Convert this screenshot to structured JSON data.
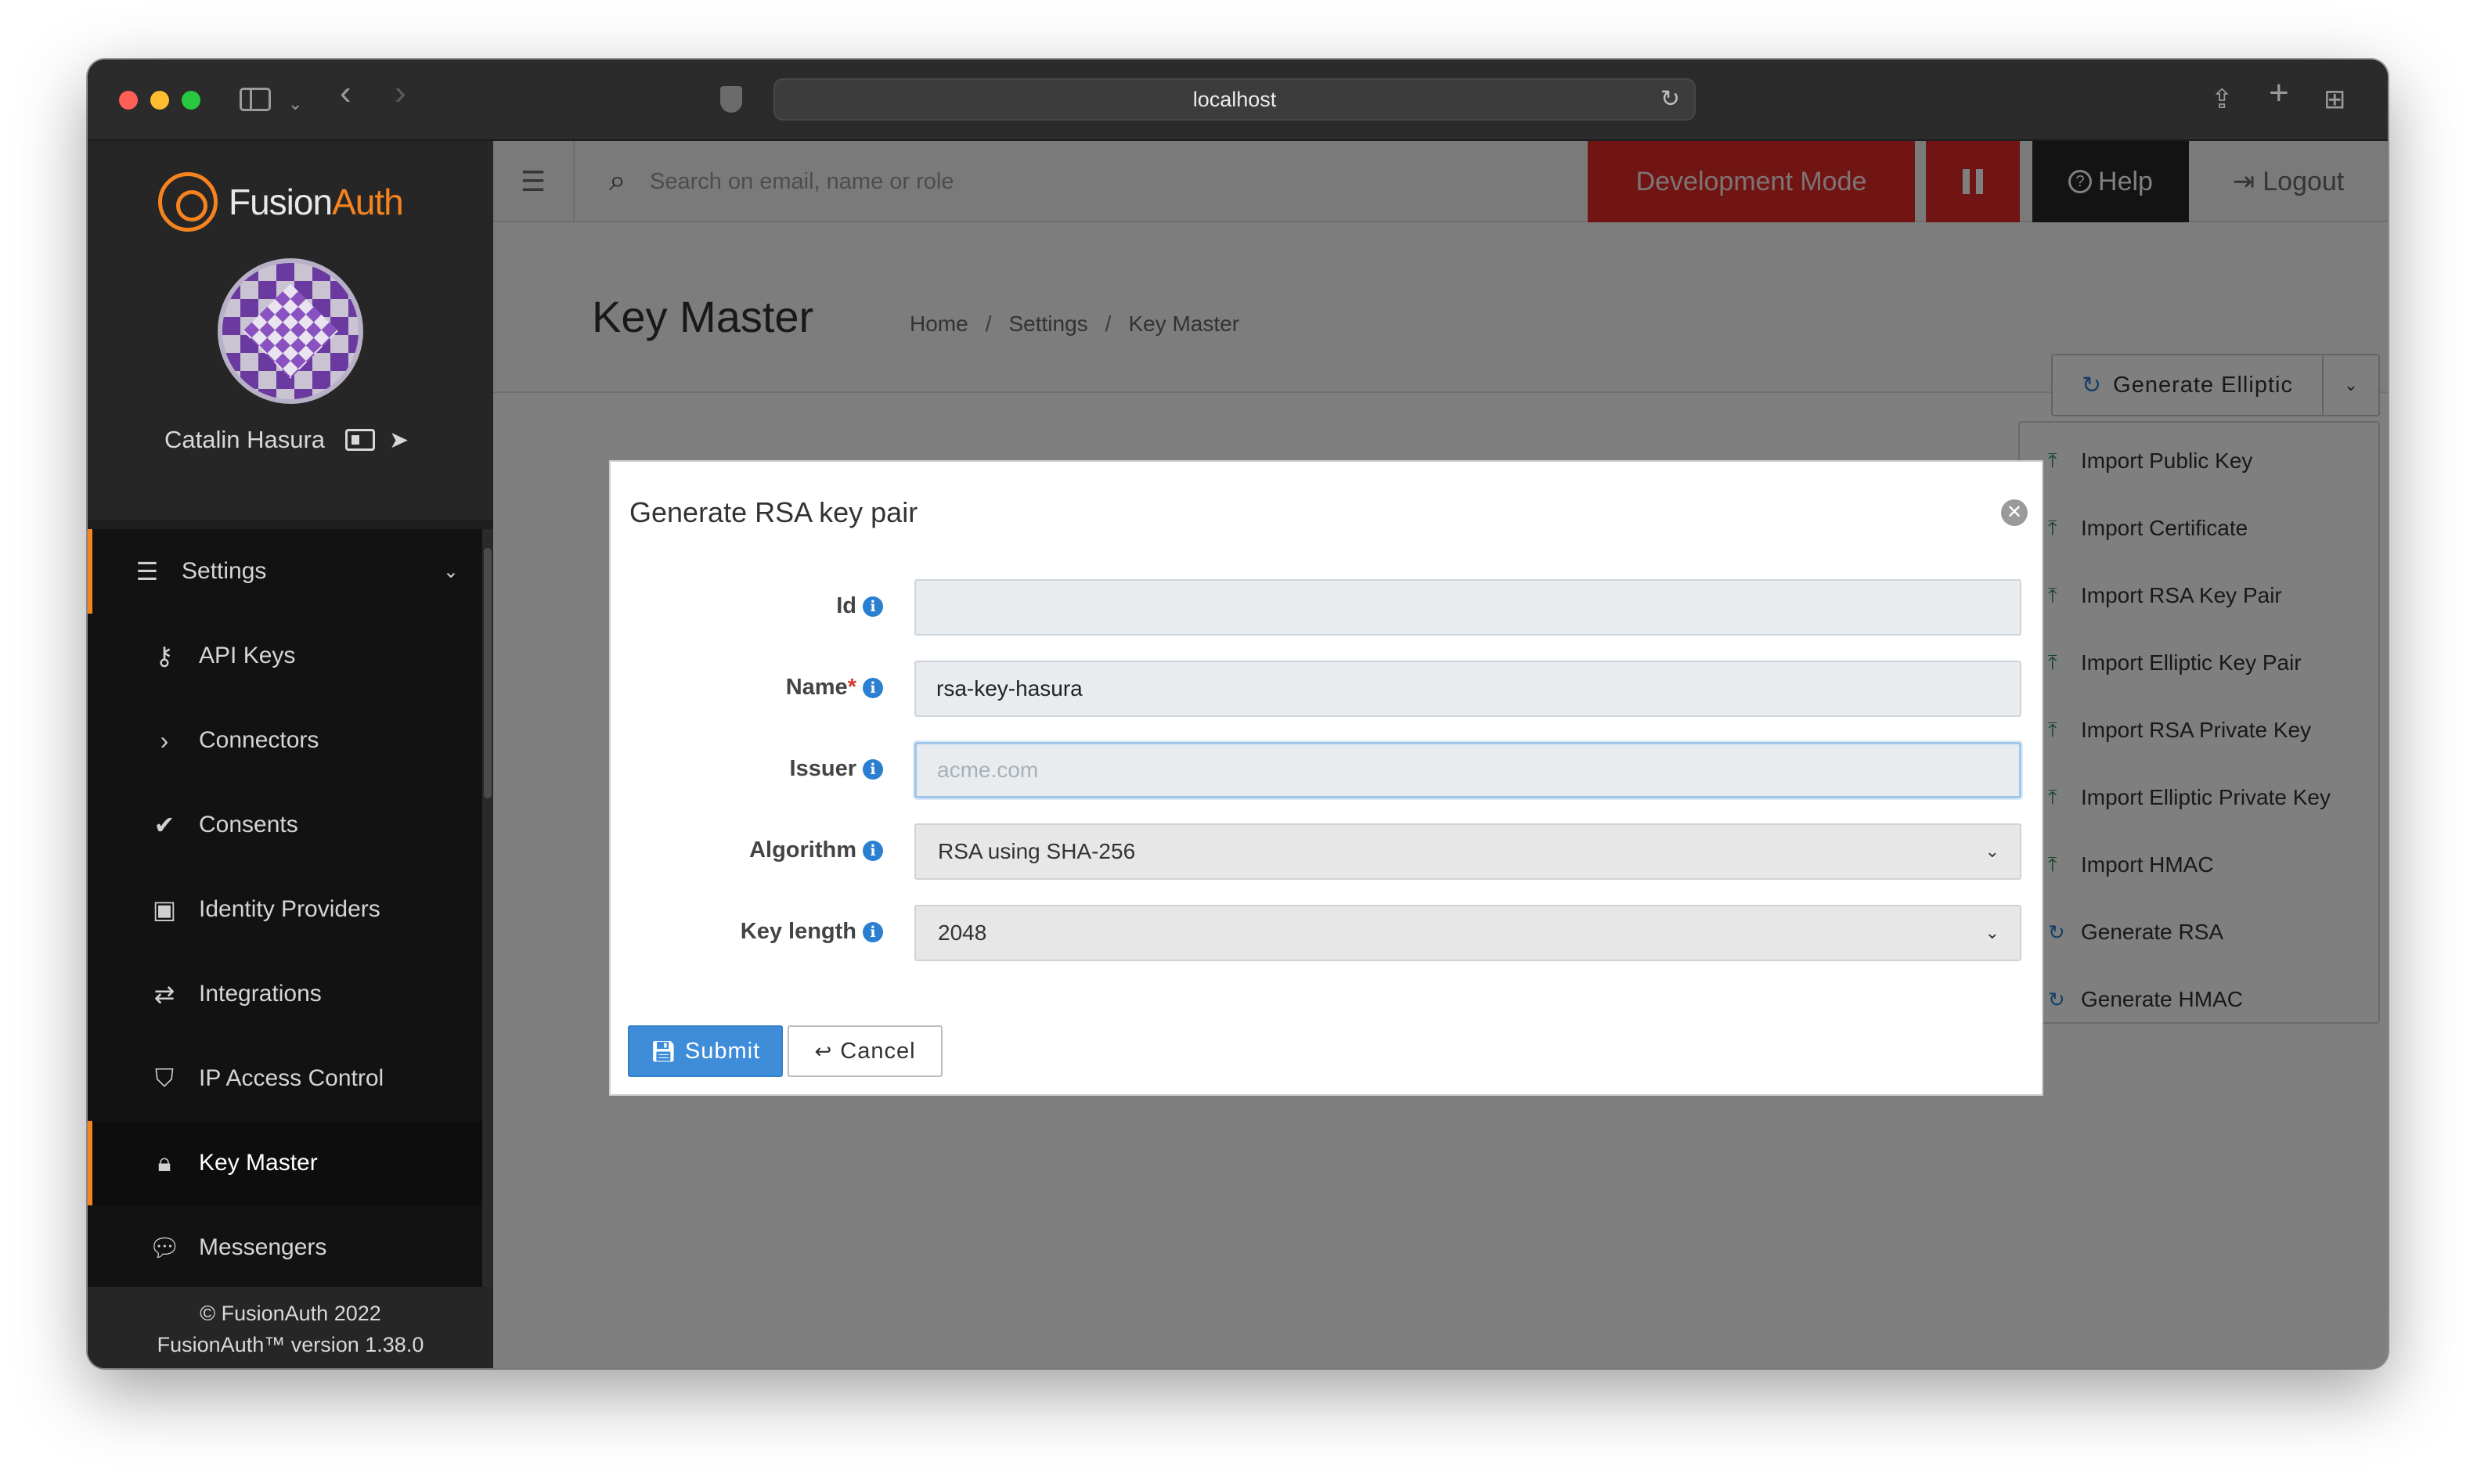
{
  "browser": {
    "url": "localhost"
  },
  "app": {
    "logo_part1": "Fusion",
    "logo_part2": "Auth",
    "user_name": "Catalin Hasura",
    "footer_copyright": "© FusionAuth 2022",
    "footer_version": "FusionAuth™ version 1.38.0"
  },
  "sidebar": {
    "section_label": "Settings",
    "items": [
      {
        "label": "API Keys",
        "icon": "key-icon"
      },
      {
        "label": "Connectors",
        "icon": "chevron-right-icon"
      },
      {
        "label": "Consents",
        "icon": "check-icon"
      },
      {
        "label": "Identity Providers",
        "icon": "id-badge-icon"
      },
      {
        "label": "Integrations",
        "icon": "exchange-icon"
      },
      {
        "label": "IP Access Control",
        "icon": "shield-icon"
      },
      {
        "label": "Key Master",
        "icon": "lock-icon",
        "active": true
      },
      {
        "label": "Messengers",
        "icon": "comments-icon"
      }
    ]
  },
  "topbar": {
    "search_placeholder": "Search on email, name or role",
    "dev_mode_label": "Development Mode",
    "help_label": "Help",
    "logout_label": "Logout",
    "accent_color": "#e02b27"
  },
  "page": {
    "title": "Key Master",
    "breadcrumb": [
      "Home",
      "Settings",
      "Key Master"
    ],
    "primary_action": "Generate Elliptic"
  },
  "dropdown": {
    "items": [
      {
        "label": "Import Public Key",
        "icon": "upload-icon"
      },
      {
        "label": "Import Certificate",
        "icon": "upload-icon"
      },
      {
        "label": "Import RSA Key Pair",
        "icon": "upload-icon"
      },
      {
        "label": "Import Elliptic Key Pair",
        "icon": "upload-icon"
      },
      {
        "label": "Import RSA Private Key",
        "icon": "upload-icon"
      },
      {
        "label": "Import Elliptic Private Key",
        "icon": "upload-icon"
      },
      {
        "label": "Import HMAC",
        "icon": "upload-icon"
      },
      {
        "label": "Generate RSA",
        "icon": "refresh-icon"
      },
      {
        "label": "Generate HMAC",
        "icon": "refresh-icon"
      }
    ]
  },
  "modal": {
    "title": "Generate RSA key pair",
    "fields": {
      "id": {
        "label": "Id",
        "value": ""
      },
      "name": {
        "label": "Name",
        "required_mark": "*",
        "value": "rsa-key-hasura"
      },
      "issuer": {
        "label": "Issuer",
        "placeholder": "acme.com",
        "value": ""
      },
      "algorithm": {
        "label": "Algorithm",
        "value": "RSA using SHA-256"
      },
      "key_length": {
        "label": "Key length",
        "value": "2048"
      }
    },
    "submit_label": "Submit",
    "cancel_label": "Cancel"
  }
}
